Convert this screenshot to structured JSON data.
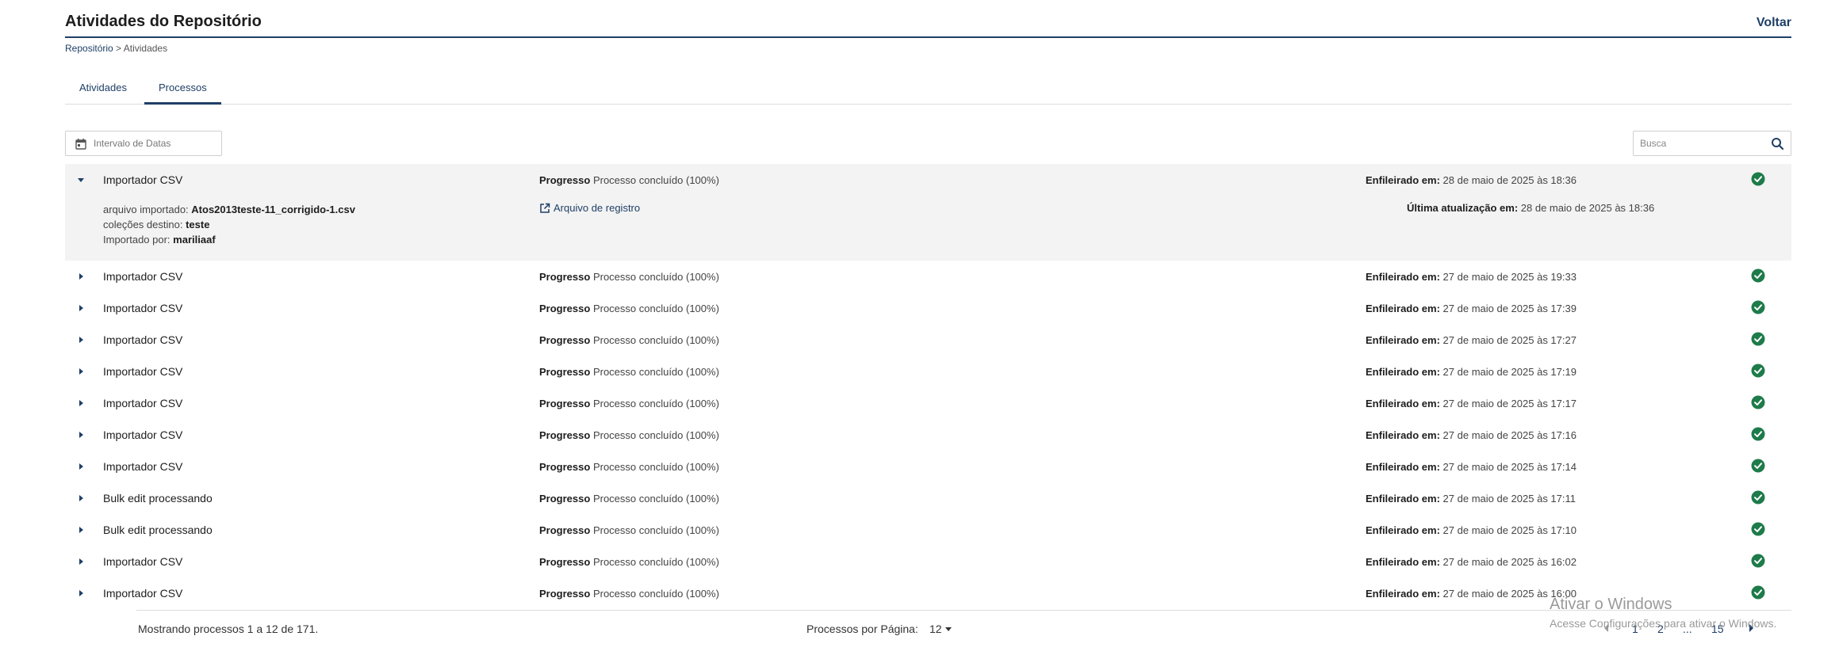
{
  "header": {
    "title": "Atividades do Repositório",
    "back_label": "Voltar"
  },
  "breadcrumb": {
    "root": "Repositório",
    "separator": ">",
    "current": "Atividades"
  },
  "tabs": [
    {
      "label": "Atividades"
    },
    {
      "label": "Processos"
    }
  ],
  "active_tab": "Processos",
  "filters": {
    "date_placeholder": "Intervalo de Datas",
    "search_placeholder": "Busca"
  },
  "labels": {
    "progress": "Progresso",
    "queued": "Enfileirado em:",
    "updated": "Última atualização em:",
    "imported_file": "arquivo importado:",
    "target_collections": "coleções destino:",
    "imported_by": "Importado por:",
    "log_file": "Arquivo de registro"
  },
  "processes": [
    {
      "name": "Importador CSV",
      "progress": "Processo concluído (100%)",
      "queued": "28 de maio de 2025 às 18:36",
      "expanded": true,
      "details": {
        "file": "Atos2013teste-11_corrigido-1.csv",
        "collections": "teste",
        "user": "mariliaaf",
        "updated": "28 de maio de 2025 às 18:36"
      }
    },
    {
      "name": "Importador CSV",
      "progress": "Processo concluído (100%)",
      "queued": "27 de maio de 2025 às 19:33"
    },
    {
      "name": "Importador CSV",
      "progress": "Processo concluído (100%)",
      "queued": "27 de maio de 2025 às 17:39"
    },
    {
      "name": "Importador CSV",
      "progress": "Processo concluído (100%)",
      "queued": "27 de maio de 2025 às 17:27"
    },
    {
      "name": "Importador CSV",
      "progress": "Processo concluído (100%)",
      "queued": "27 de maio de 2025 às 17:19"
    },
    {
      "name": "Importador CSV",
      "progress": "Processo concluído (100%)",
      "queued": "27 de maio de 2025 às 17:17"
    },
    {
      "name": "Importador CSV",
      "progress": "Processo concluído (100%)",
      "queued": "27 de maio de 2025 às 17:16"
    },
    {
      "name": "Importador CSV",
      "progress": "Processo concluído (100%)",
      "queued": "27 de maio de 2025 às 17:14"
    },
    {
      "name": "Bulk edit processando",
      "progress": "Processo concluído (100%)",
      "queued": "27 de maio de 2025 às 17:11"
    },
    {
      "name": "Bulk edit processando",
      "progress": "Processo concluído (100%)",
      "queued": "27 de maio de 2025 às 17:10"
    },
    {
      "name": "Importador CSV",
      "progress": "Processo concluído (100%)",
      "queued": "27 de maio de 2025 às 16:02"
    },
    {
      "name": "Importador CSV",
      "progress": "Processo concluído (100%)",
      "queued": "27 de maio de 2025 às 16:00"
    }
  ],
  "footer": {
    "showing": "Mostrando processos 1 a 12 de 171.",
    "per_page_label": "Processos por Página:",
    "per_page_value": "12",
    "pages": [
      "1",
      "2",
      "...",
      "15"
    ]
  },
  "watermark": {
    "title": "Ativar o Windows",
    "subtitle": "Acesse Configurações para ativar o Windows."
  },
  "colors": {
    "accent": "#1f3f67",
    "success": "#1e7b4a",
    "expanded_bg": "#f3f3f3"
  },
  "icons": {
    "date": "calendar-icon",
    "search": "search-icon",
    "expand": "caret-right-icon",
    "collapse": "caret-down-icon",
    "status": "check-circle-icon",
    "log": "external-link-icon"
  }
}
